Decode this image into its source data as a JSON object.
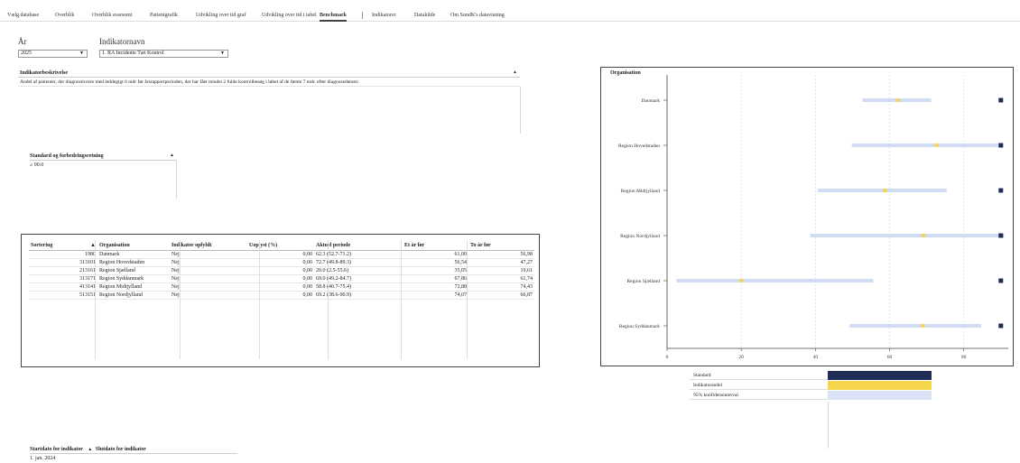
{
  "tabs": [
    {
      "label": "Vælg database",
      "active": false
    },
    {
      "label": "Overblik",
      "active": false
    },
    {
      "label": "Overblik svarsomt",
      "active": false
    },
    {
      "label": "Patientgrafik",
      "active": false
    },
    {
      "label": "Udvikling over tid graf",
      "active": false
    },
    {
      "label": "Udvikling over tid i tabel",
      "active": false
    },
    {
      "label": "Benchmark",
      "active": true
    },
    {
      "label": "Indikatorer",
      "active": false
    },
    {
      "label": "Datakilde",
      "active": false
    },
    {
      "label": "Om SundK's datavisning",
      "active": false
    }
  ],
  "filters": {
    "year_label": "År",
    "year_value": "2025",
    "indicator_label": "Indikatornavn",
    "indicator_value": "1. RA Incidente Tæt Kontrol"
  },
  "description": {
    "header": "Indikatorbeskrivelse",
    "text": "Andel af patienter, der diagnosticeres med leddegigt 6 mdr før årsrapportperioden, der har fået mindst 2 fulde kontrolbesøg i løbet af de første 7 mdr. efter diagnosedatoen"
  },
  "standard": {
    "header": "Standard og forbedringsretning",
    "value": "≥ 90.0"
  },
  "table": {
    "columns": [
      "Sortering",
      "Organisation",
      "Indikator opfyldt",
      "Uoplyst (%)",
      "Aktuel periode",
      "Et år før",
      "To år før"
    ],
    "rows": [
      [
        "1980",
        "Danmark",
        "Nej",
        "0,00",
        "62.3 (52.7-71.2)",
        "61,00",
        "56,98"
      ],
      [
        "313101",
        "Region Hovedstaden",
        "Nej",
        "0,00",
        "72.7 (49.8-89.3)",
        "56,54",
        "47,27"
      ],
      [
        "213161",
        "Region Sjælland",
        "Nej",
        "0,00",
        "20.0 (2.5-55.6)",
        "35,05",
        "19,61"
      ],
      [
        "313171",
        "Region Syddanmark",
        "Nej",
        "0,00",
        "69.0 (49.2-84.7)",
        "67,86",
        "61,74"
      ],
      [
        "413141",
        "Region Midtjylland",
        "Nej",
        "0,00",
        "58.8 (40.7-75.4)",
        "72,88",
        "74,43"
      ],
      [
        "513151",
        "Region Nordjylland",
        "Nej",
        "0,00",
        "69.2 (38.6-90.9)",
        "74,07",
        "66,87"
      ]
    ]
  },
  "chart_data": {
    "type": "scatter",
    "title": "Organisation",
    "categories": [
      "Danmark",
      "Region Hovedstaden",
      "Region Midtjylland",
      "Region Nordjylland",
      "Region Sjælland",
      "Region Syddanmark"
    ],
    "indicator": [
      62.3,
      72.7,
      58.8,
      69.2,
      20.0,
      69.0
    ],
    "ci_low": [
      52.7,
      49.8,
      40.7,
      38.6,
      2.5,
      49.2
    ],
    "ci_high": [
      71.2,
      89.3,
      75.4,
      90.9,
      55.6,
      84.7
    ],
    "standard": [
      90,
      90,
      90,
      90,
      90,
      90
    ],
    "xlim": [
      0,
      92
    ],
    "xticks": [
      0,
      20,
      40,
      60,
      80
    ],
    "grid": true
  },
  "legend": [
    {
      "label": "Standard",
      "color": "#1f2d57"
    },
    {
      "label": "Indikatorandel",
      "color": "#f5d54a"
    },
    {
      "label": "95% konfidensinterval",
      "color": "#d9e3f5"
    }
  ],
  "colors": {
    "standard": "#1f2d57",
    "indicator": "#f5d54a",
    "ci": "#cfdcf3",
    "grid": "#cfd8e6"
  },
  "dates": {
    "start_header": "Startdato for indikator",
    "end_header": "Slutdato for indikator",
    "start_value": "1. jan. 2024",
    "end_value": ""
  }
}
